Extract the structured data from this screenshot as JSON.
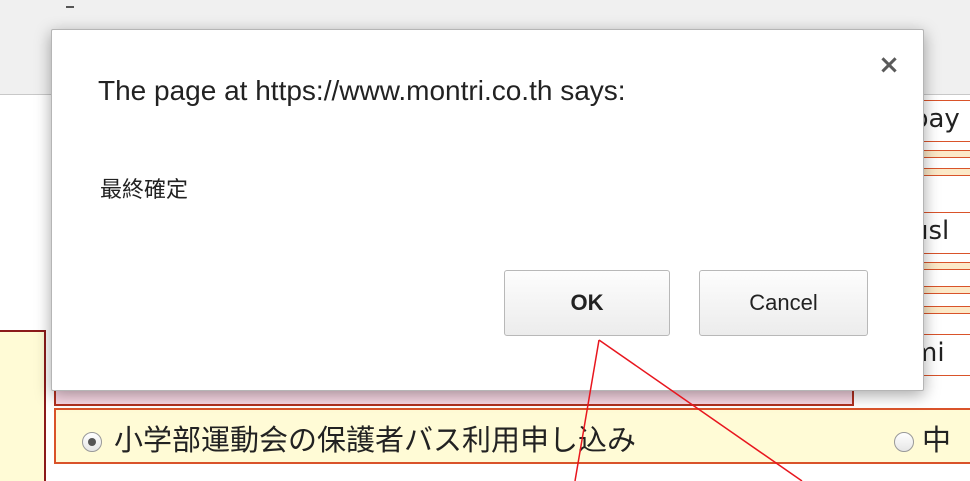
{
  "dialog": {
    "title": "The page at https://www.montri.co.th says:",
    "close_icon": "close-icon",
    "close_glyph": "×",
    "message": "最終確定",
    "ok_label": "OK",
    "cancel_label": "Cancel"
  },
  "background": {
    "right_fields": [
      "pay",
      "usl",
      "mi"
    ],
    "form_row": {
      "option_1_label": "小学部運動会の保護者バス利用申し込み",
      "option_1_checked": true,
      "option_2_label": "中",
      "option_2_checked": false
    }
  },
  "colors": {
    "annotation_line": "#e8161e",
    "form_border": "#d9532a",
    "form_fill": "#fffbd6",
    "pink_fill": "#f8d7e4",
    "dark_red": "#8b1a1a"
  }
}
